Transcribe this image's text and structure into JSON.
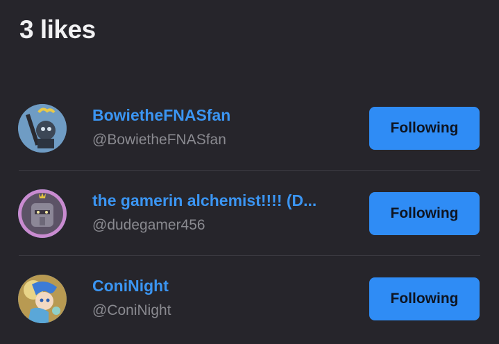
{
  "header": {
    "title": "3 likes"
  },
  "users": [
    {
      "name": "BowietheFNASfan",
      "handle": "@BowietheFNASfan",
      "button_label": "Following",
      "avatar": "avatar-bowie-icon"
    },
    {
      "name": "the gamerin alchemist!!!! (D...",
      "handle": "@dudegamer456",
      "button_label": "Following",
      "avatar": "avatar-armor-icon"
    },
    {
      "name": "ConiNight",
      "handle": "@ConiNight",
      "button_label": "Following",
      "avatar": "avatar-anime-icon"
    }
  ],
  "colors": {
    "background": "#26252b",
    "accent": "#2f8cf5",
    "name": "#3b95f2",
    "handle": "#8a8a90"
  }
}
